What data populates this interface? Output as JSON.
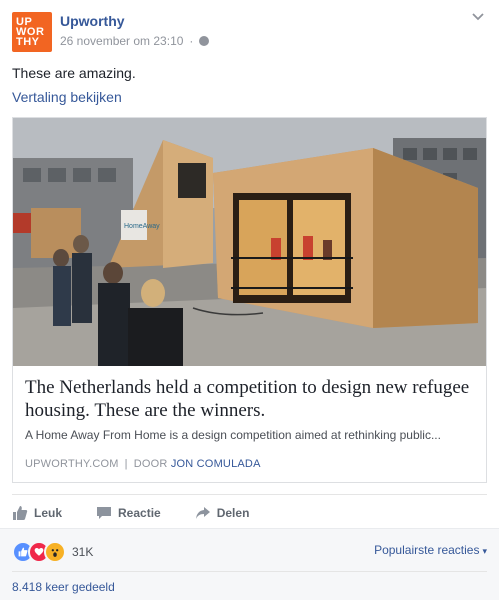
{
  "post": {
    "logo": {
      "line1": "UP",
      "line2": "WOR",
      "line3": "THY"
    },
    "author": "Upworthy",
    "timestamp": "26 november om 23:10",
    "message": "These are amazing.",
    "translate_link": "Vertaling bekijken"
  },
  "card": {
    "title": "The Netherlands held a competition to design new refugee housing. These are the winners.",
    "description": "A Home Away From Home is a design competition aimed at rethinking public...",
    "source": "UPWORTHY.COM",
    "byline_prefix": "DOOR",
    "byline_author": "JON COMULADA",
    "sign_text": "HomeAway"
  },
  "actions": {
    "like": "Leuk",
    "comment": "Reactie",
    "share": "Delen"
  },
  "footer": {
    "reaction_count": "31K",
    "sort_label": "Populairste reacties",
    "shares": "8.418 keer gedeeld"
  },
  "colors": {
    "brand": "#f26522",
    "link": "#365899",
    "like": "#5890ff",
    "love": "#f0284a",
    "wow": "#f7b125"
  },
  "icons": [
    "globe-icon",
    "chevron-down-icon",
    "thumbs-up-icon",
    "comment-icon",
    "share-arrow-icon",
    "like-reaction-icon",
    "love-reaction-icon",
    "wow-reaction-icon"
  ]
}
